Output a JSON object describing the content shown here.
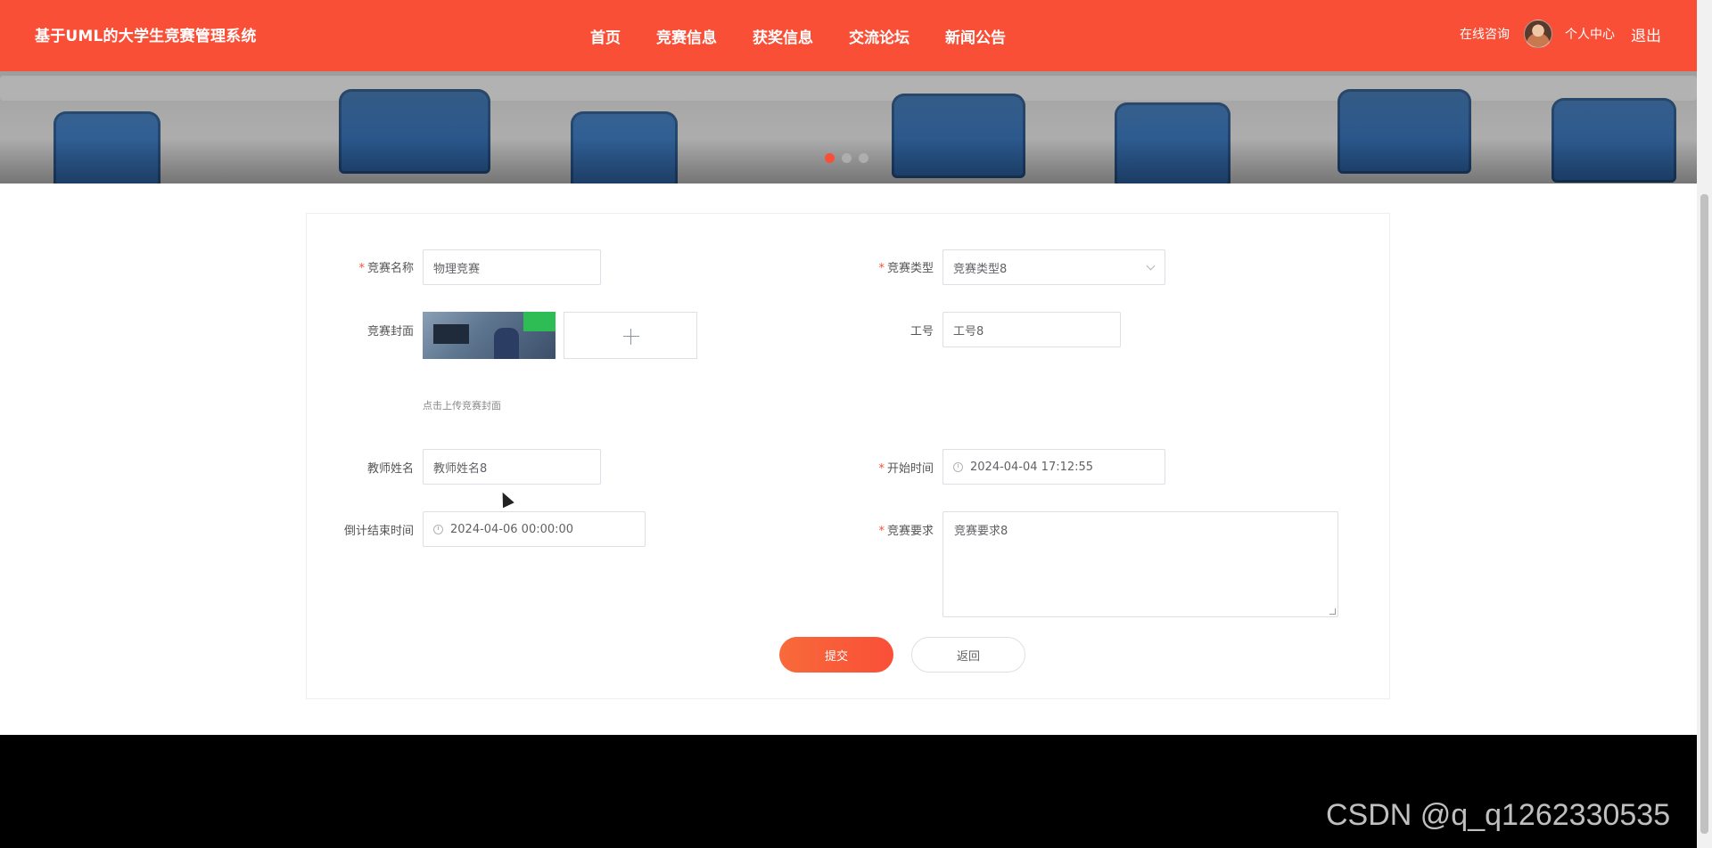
{
  "header": {
    "brand": "基于UML的大学生竞赛管理系统",
    "nav": [
      "首页",
      "竞赛信息",
      "获奖信息",
      "交流论坛",
      "新闻公告"
    ],
    "consult": "在线咨询",
    "user_center": "个人中心",
    "logout": "退出"
  },
  "banner": {
    "slides": 3,
    "active_slide": 1
  },
  "form": {
    "competition_name": {
      "label": "竞赛名称",
      "required": true,
      "value": "物理竞赛"
    },
    "competition_type": {
      "label": "竞赛类型",
      "required": true,
      "value": "竞赛类型8"
    },
    "cover": {
      "label": "竞赛封面",
      "hint": "点击上传竞赛封面"
    },
    "job_number": {
      "label": "工号",
      "value": "工号8"
    },
    "teacher_name": {
      "label": "教师姓名",
      "value": "教师姓名8"
    },
    "start_time": {
      "label": "开始时间",
      "required": true,
      "value": "2024-04-04 17:12:55"
    },
    "countdown_end": {
      "label": "倒计结束时间",
      "value": "2024-04-06 00:00:00"
    },
    "requirements": {
      "label": "竞赛要求",
      "required": true,
      "value": "竞赛要求8"
    },
    "submit_label": "提交",
    "back_label": "返回"
  },
  "watermark": "CSDN @q_q1262330535",
  "colors": {
    "accent": "#f94f37",
    "footer": "#000000"
  }
}
